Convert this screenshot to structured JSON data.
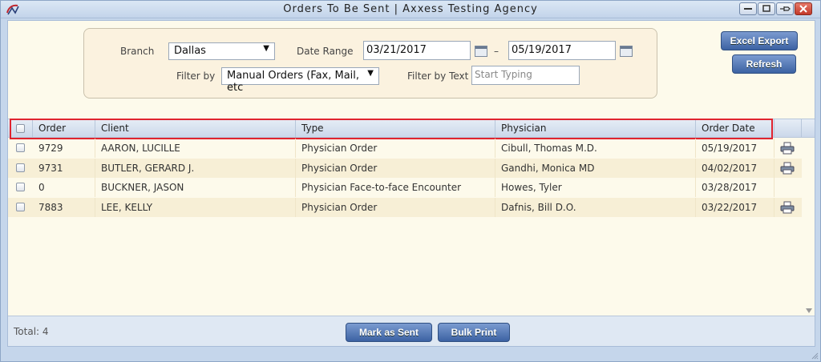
{
  "window": {
    "title": "Orders To Be Sent | Axxess Testing Agency"
  },
  "filters": {
    "branch_label": "Branch",
    "branch_value": "Dallas",
    "date_range_label": "Date Range",
    "date_from": "03/21/2017",
    "date_separator": "–",
    "date_to": "05/19/2017",
    "filter_by_label": "Filter by",
    "filter_by_value": "Manual Orders (Fax, Mail, etc",
    "filter_text_label": "Filter by Text",
    "filter_text_placeholder": "Start Typing"
  },
  "actions": {
    "excel_export": "Excel Export",
    "refresh": "Refresh"
  },
  "table": {
    "columns": [
      "Order",
      "Client",
      "Type",
      "Physician",
      "Order Date"
    ],
    "rows": [
      {
        "order": "9729",
        "client": "AARON, LUCILLE",
        "type": "Physician Order",
        "physician": "Cibull, Thomas M.D.",
        "date": "05/19/2017",
        "print": true
      },
      {
        "order": "9731",
        "client": "BUTLER, GERARD J.",
        "type": "Physician Order",
        "physician": "Gandhi, Monica MD",
        "date": "04/02/2017",
        "print": true
      },
      {
        "order": "0",
        "client": "BUCKNER, JASON",
        "type": "Physician Face-to-face Encounter",
        "physician": "Howes, Tyler",
        "date": "03/28/2017",
        "print": false
      },
      {
        "order": "7883",
        "client": "LEE, KELLY",
        "type": "Physician Order",
        "physician": "Dafnis, Bill D.O.",
        "date": "03/22/2017",
        "print": true
      }
    ]
  },
  "footer": {
    "total": "Total: 4",
    "mark_as_sent": "Mark as Sent",
    "bulk_print": "Bulk Print"
  },
  "colors": {
    "accent": "#3c62a3",
    "highlight": "#e0242f",
    "row_alt": "#f7efd6"
  }
}
